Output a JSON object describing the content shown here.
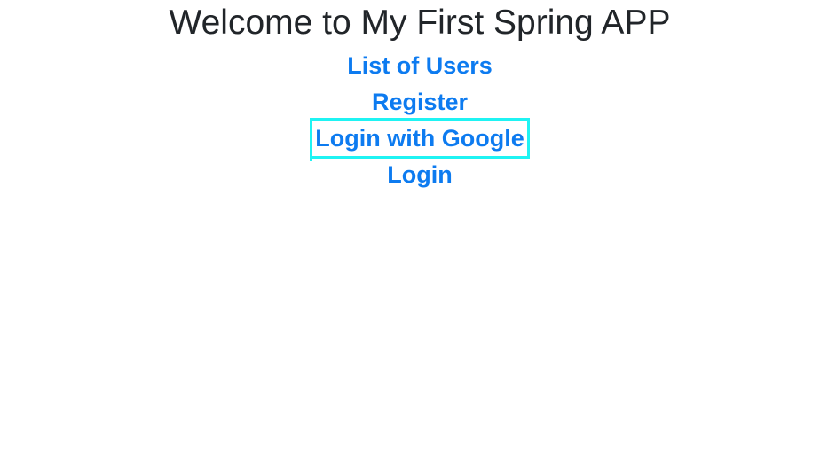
{
  "page": {
    "title": "Welcome to My First Spring APP",
    "links": [
      {
        "label": "List of Users"
      },
      {
        "label": "Register"
      },
      {
        "label": "Login with Google"
      },
      {
        "label": "Login"
      }
    ],
    "highlight_color": "#1ff3f3",
    "link_color": "#0d7bf0",
    "title_color": "#212529"
  }
}
